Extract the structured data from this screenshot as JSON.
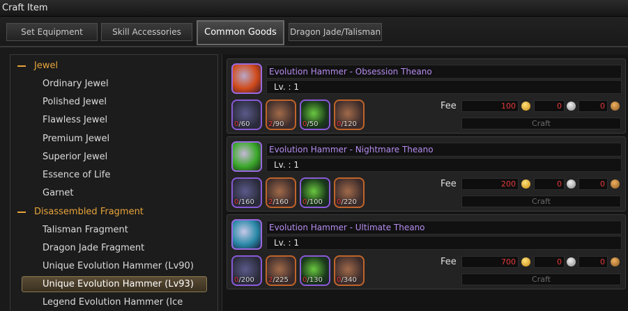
{
  "window": {
    "title": "Craft Item"
  },
  "tabs": [
    {
      "label": "Set Equipment"
    },
    {
      "label": "Skill Accessories"
    },
    {
      "label": "Common Goods"
    },
    {
      "label": "Dragon Jade/Talisman"
    }
  ],
  "categories": {
    "jewel": {
      "label": "Jewel",
      "items": [
        "Ordinary Jewel",
        "Polished Jewel",
        "Flawless Jewel",
        "Premium Jewel",
        "Superior Jewel",
        "Essence of Life",
        "Garnet"
      ]
    },
    "fragment": {
      "label": "Disassembled Fragment",
      "items": [
        "Talisman Fragment",
        "Dragon Jade Fragment",
        "Unique Evolution Hammer (Lv90)",
        "Unique Evolution Hammer (Lv93)",
        "Legend Evolution Hammer (Ice Dragon)"
      ]
    }
  },
  "recipes": [
    {
      "name": "Evolution Hammer - Obsession Theano",
      "level": "Lv. : 1",
      "materials": [
        {
          "have": "0",
          "need": "/60"
        },
        {
          "have": "2",
          "need": "/90"
        },
        {
          "have": "0",
          "need": "/50"
        },
        {
          "have": "0",
          "need": "/120"
        }
      ],
      "fee_label": "Fee",
      "fee_gold": "100",
      "fee_silver": "0",
      "fee_copper": "0",
      "craft_label": "Craft"
    },
    {
      "name": "Evolution Hammer - Nightmare Theano",
      "level": "Lv. : 1",
      "materials": [
        {
          "have": "0",
          "need": "/160"
        },
        {
          "have": "2",
          "need": "/160"
        },
        {
          "have": "0",
          "need": "/100"
        },
        {
          "have": "0",
          "need": "/220"
        }
      ],
      "fee_label": "Fee",
      "fee_gold": "200",
      "fee_silver": "0",
      "fee_copper": "0",
      "craft_label": "Craft"
    },
    {
      "name": "Evolution Hammer - Ultimate Theano",
      "level": "Lv. : 1",
      "materials": [
        {
          "have": "0",
          "need": "/200"
        },
        {
          "have": "2",
          "need": "/225"
        },
        {
          "have": "0",
          "need": "/130"
        },
        {
          "have": "0",
          "need": "/340"
        }
      ],
      "fee_label": "Fee",
      "fee_gold": "700",
      "fee_silver": "0",
      "fee_copper": "0",
      "craft_label": "Craft"
    }
  ],
  "colors": {
    "accent": "#e8a43a",
    "item_name": "#b58cf0",
    "missing": "#e83a3a"
  }
}
